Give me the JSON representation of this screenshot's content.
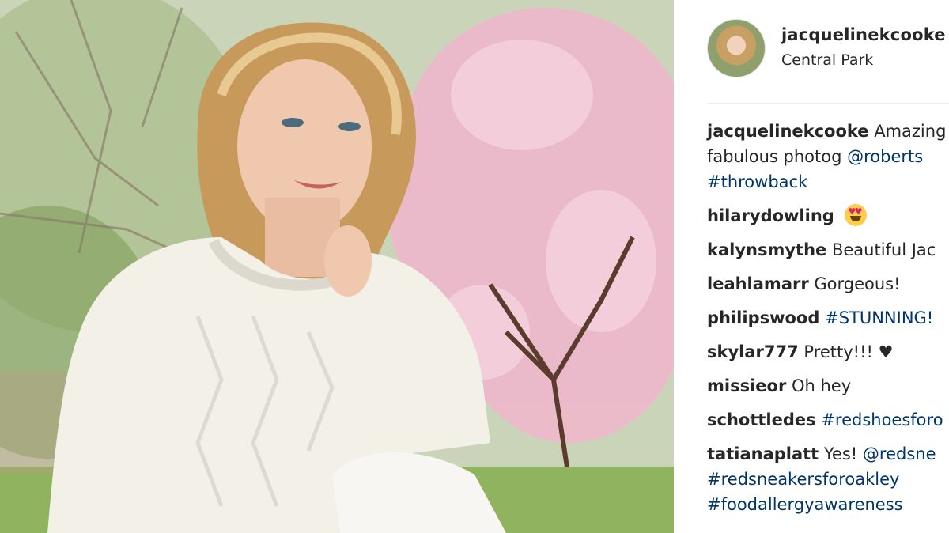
{
  "post": {
    "username": "jacquelinekcooke",
    "location": "Central Park"
  },
  "comments": [
    {
      "author": "jacquelinekcooke",
      "lines": [
        [
          {
            "t": " Amazing ",
            "k": "text"
          }
        ],
        [
          {
            "t": "fabulous photog ",
            "k": "text"
          },
          {
            "t": "@roberts",
            "k": "tag"
          }
        ],
        [
          {
            "t": "#throwback",
            "k": "tag"
          }
        ]
      ]
    },
    {
      "author": "hilarydowling",
      "lines": [
        [
          {
            "t": " ",
            "k": "text"
          },
          {
            "t": "heart-eyes-emoji",
            "k": "emoji"
          }
        ]
      ]
    },
    {
      "author": "kalynsmythe",
      "lines": [
        [
          {
            "t": " Beautiful Jac",
            "k": "text"
          }
        ]
      ]
    },
    {
      "author": "leahlamarr",
      "lines": [
        [
          {
            "t": " Gorgeous!",
            "k": "text"
          }
        ]
      ]
    },
    {
      "author": "philipswood",
      "lines": [
        [
          {
            "t": " ",
            "k": "text"
          },
          {
            "t": "#STUNNING!",
            "k": "tag"
          }
        ]
      ]
    },
    {
      "author": "skylar777",
      "lines": [
        [
          {
            "t": " Pretty!!! ♥",
            "k": "text"
          }
        ]
      ]
    },
    {
      "author": "missieor",
      "lines": [
        [
          {
            "t": " Oh hey",
            "k": "text"
          }
        ]
      ]
    },
    {
      "author": "schottledes",
      "lines": [
        [
          {
            "t": " ",
            "k": "text"
          },
          {
            "t": "#redshoesforo",
            "k": "tag"
          }
        ]
      ]
    },
    {
      "author": "tatianaplatt",
      "lines": [
        [
          {
            "t": " Yes! ",
            "k": "text"
          },
          {
            "t": "@redsne",
            "k": "tag"
          }
        ],
        [
          {
            "t": "#redsneakersforoakley",
            "k": "tag"
          }
        ],
        [
          {
            "t": "#foodallergyawareness",
            "k": "tag"
          }
        ]
      ]
    }
  ],
  "colors": {
    "text": "#262626",
    "link": "#003569",
    "divider": "#efefef"
  }
}
